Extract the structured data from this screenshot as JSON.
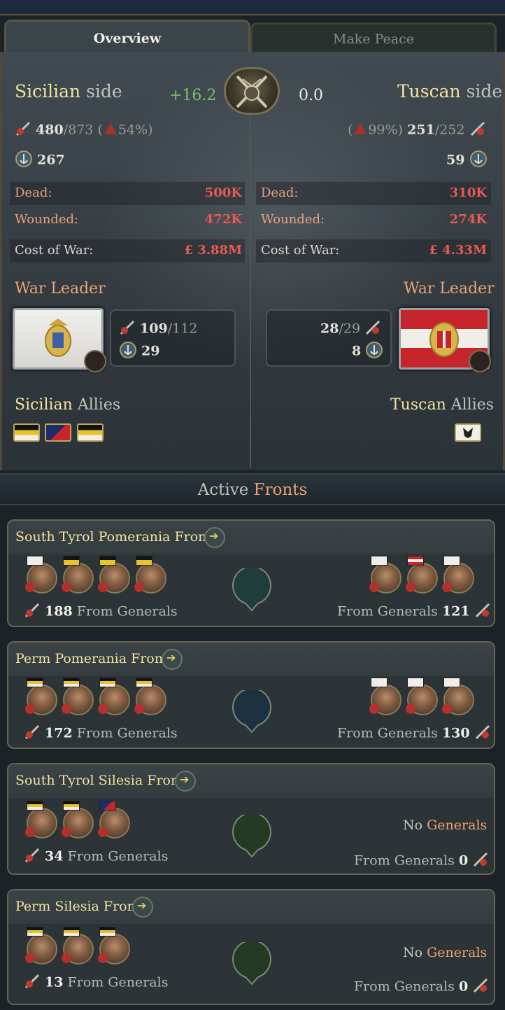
{
  "tabs": {
    "overview": "Overview",
    "make_peace": "Make Peace"
  },
  "left": {
    "side_name": "Sicilian",
    "side_word": "side",
    "score": "+16.2",
    "army": "480",
    "army_max": "/873",
    "army_pct_open": "(",
    "army_pct": "54%)",
    "navy": "267",
    "dead_label": "Dead:",
    "dead": "500K",
    "wounded_label": "Wounded:",
    "wounded": "472K",
    "cost_label": "Cost of War:",
    "cost": "£ 3.88M",
    "war_leader": "War Leader",
    "leader_army": "109",
    "leader_army_max": "/112",
    "leader_navy": "29",
    "allies_name": "Sicilian",
    "allies_word": "Allies"
  },
  "right": {
    "side_name": "Tuscan",
    "side_word": "side",
    "score": "0.0",
    "army_pct_open": "(",
    "army_pct": "99%)",
    "army": "251",
    "army_max": "/252",
    "navy": "59",
    "dead_label": "Dead:",
    "dead": "310K",
    "wounded_label": "Wounded:",
    "wounded": "274K",
    "cost_label": "Cost of War:",
    "cost": "£ 4.33M",
    "war_leader": "War Leader",
    "leader_army": "28",
    "leader_army_max": "/29",
    "leader_navy": "8",
    "allies_name": "Tuscan",
    "allies_word": "Allies"
  },
  "fronts_header": {
    "a": "Active",
    "b": "Fronts"
  },
  "fronts": [
    {
      "name": "South Tyrol Pomerania Front",
      "left_count": "188",
      "left_text": "From Generals",
      "right_text": "From Generals",
      "right_count": "121"
    },
    {
      "name": "Perm Pomerania Front",
      "left_count": "172",
      "left_text": "From Generals",
      "right_text": "From Generals",
      "right_count": "130"
    },
    {
      "name": "South Tyrol Silesia Front",
      "left_count": "34",
      "left_text": "From Generals",
      "no_a": "No",
      "no_b": "Generals",
      "right_text": "From Generals",
      "right_count": "0"
    },
    {
      "name": "Perm Silesia Front",
      "left_count": "13",
      "left_text": "From Generals",
      "no_a": "No",
      "no_b": "Generals",
      "right_text": "From Generals",
      "right_count": "0"
    }
  ],
  "colors": {
    "gold_text": "#f3e3a0",
    "orange_text": "#e9a273",
    "red_value": "#e85a55",
    "green_score": "#7cc46a"
  },
  "icons": [
    "army-icon",
    "navy-anchor-icon",
    "war-emblem-icon",
    "go-to-front-icon",
    "general-portrait"
  ]
}
